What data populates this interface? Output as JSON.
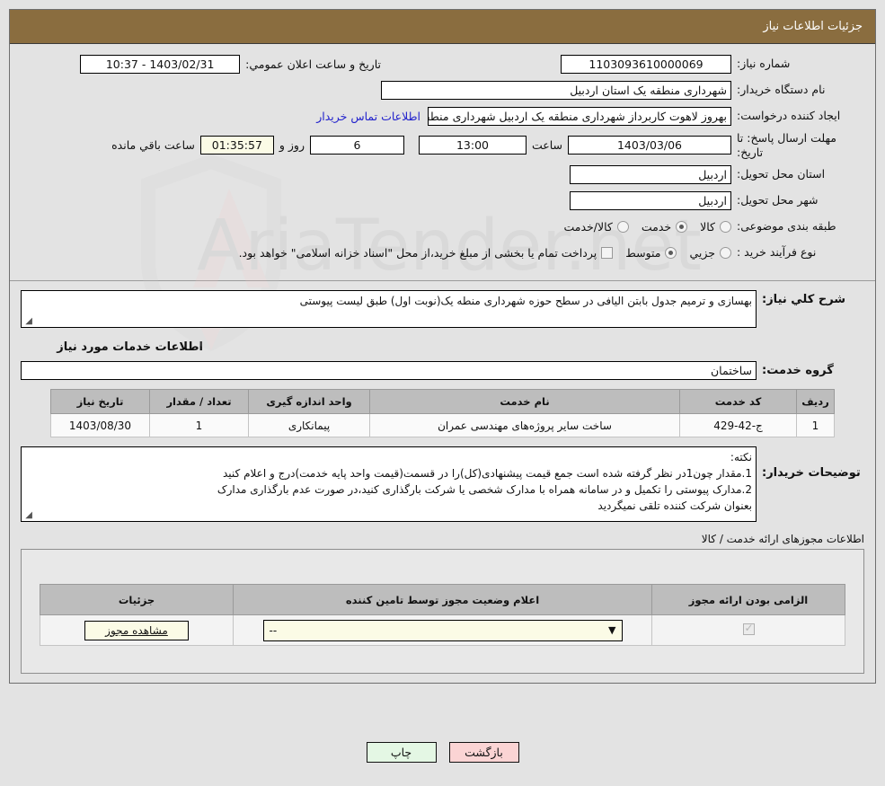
{
  "header": {
    "title": "جزئیات اطلاعات نیاز"
  },
  "fields": {
    "need_number_label": "شماره نیاز:",
    "need_number_value": "1103093610000069",
    "announce_label": "تاریخ و ساعت اعلان عمومي:",
    "announce_value": "1403/02/31 - 10:37",
    "buyer_org_label": "نام دستگاه خریدار:",
    "buyer_org_value": "شهرداری منطقه یک استان اردبیل",
    "creator_label": "ایجاد کننده درخواست:",
    "creator_value": "بهروز لاهوت کاربرداز شهرداری منطقه یک اردبیل شهرداری منطقه یک استان اردبیل",
    "buyer_contact_link": "اطلاعات تماس خریدار",
    "deadline_label": "مهلت ارسال پاسخ: تا تاریخ:",
    "deadline_date": "1403/03/06",
    "deadline_time_label": "ساعت",
    "deadline_time": "13:00",
    "days_value": "6",
    "days_label": "روز و",
    "countdown_value": "01:35:57",
    "countdown_label": "ساعت باقي مانده",
    "province_label": "استان محل تحویل:",
    "province_value": "اردبیل",
    "city_label": "شهر محل تحویل:",
    "city_value": "اردبیل",
    "category_label": "طبقه بندی موضوعی:",
    "category_options": [
      "کالا",
      "خدمت",
      "کالا/خدمت"
    ],
    "category_selected": "خدمت",
    "process_label": "نوع فرآیند خرید :",
    "process_options": [
      "جزیي",
      "متوسط"
    ],
    "process_selected": "متوسط",
    "treasury_checkbox_label": "پرداخت تمام یا بخشی از مبلغ خرید،از محل \"اسناد خزانه اسلامی\" خواهد بود.",
    "treasury_checked": false
  },
  "description": {
    "need_desc_label": "شرح كلي نياز:",
    "need_desc_value": "بهسازی و ترمیم جدول بابتن الیافی در سطح حوزه شهرداری منطه یک(نوبت اول) طبق لیست پیوستی",
    "services_section_title": "اطلاعات خدمات مورد نیاز",
    "service_group_label": "گروه خدمت:",
    "service_group_value": "ساختمان"
  },
  "services_table": {
    "columns": [
      "ردیف",
      "کد خدمت",
      "نام خدمت",
      "واحد اندازه گیری",
      "تعداد / مقدار",
      "تاریخ نیاز"
    ],
    "rows": [
      {
        "row": "1",
        "code": "ج-42-429",
        "name": "ساخت سایر پروژه‌های مهندسی عمران",
        "unit": "پیمانکاری",
        "quantity": "1",
        "need_date": "1403/08/30"
      }
    ]
  },
  "buyer_notes": {
    "label": "توضیحات خریدار:",
    "lines": [
      "نکته:",
      "1.مقدار چون1در نظر گرفته شده است جمع قیمت پیشنهادی(کل)را در قسمت(قیمت واحد پایه خدمت)درج و اعلام کنید",
      "2.مدارک پیوستی را تکمیل و در سامانه همراه با مدارک شخصی یا شرکت بارگذاری کنید،در صورت عدم بارگذاری مدارک",
      "بعنوان شرکت کننده تلقی نمیگردید"
    ]
  },
  "permits": {
    "title": "اطلاعات مجوزهای ارائه خدمت / کالا",
    "columns": [
      "الزامی بودن ارائه مجوز",
      "اعلام وضعیت مجوز توسط تامین کننده",
      "جزئیات"
    ],
    "rows": [
      {
        "required_checked": true,
        "status_value": "--",
        "details_button": "مشاهده مجوز"
      }
    ]
  },
  "footer": {
    "back_button": "بازگشت",
    "print_button": "چاپ"
  },
  "colors": {
    "header_bg": "#8a6d3f",
    "link": "#2222cc",
    "countdown_bg": "#fbfbe6",
    "back_button_bg": "#fbd4d4",
    "print_button_bg": "#e4f7e4",
    "table_header_bg": "#bdbdbd"
  },
  "watermark": {
    "text": "AriaTender.net"
  }
}
